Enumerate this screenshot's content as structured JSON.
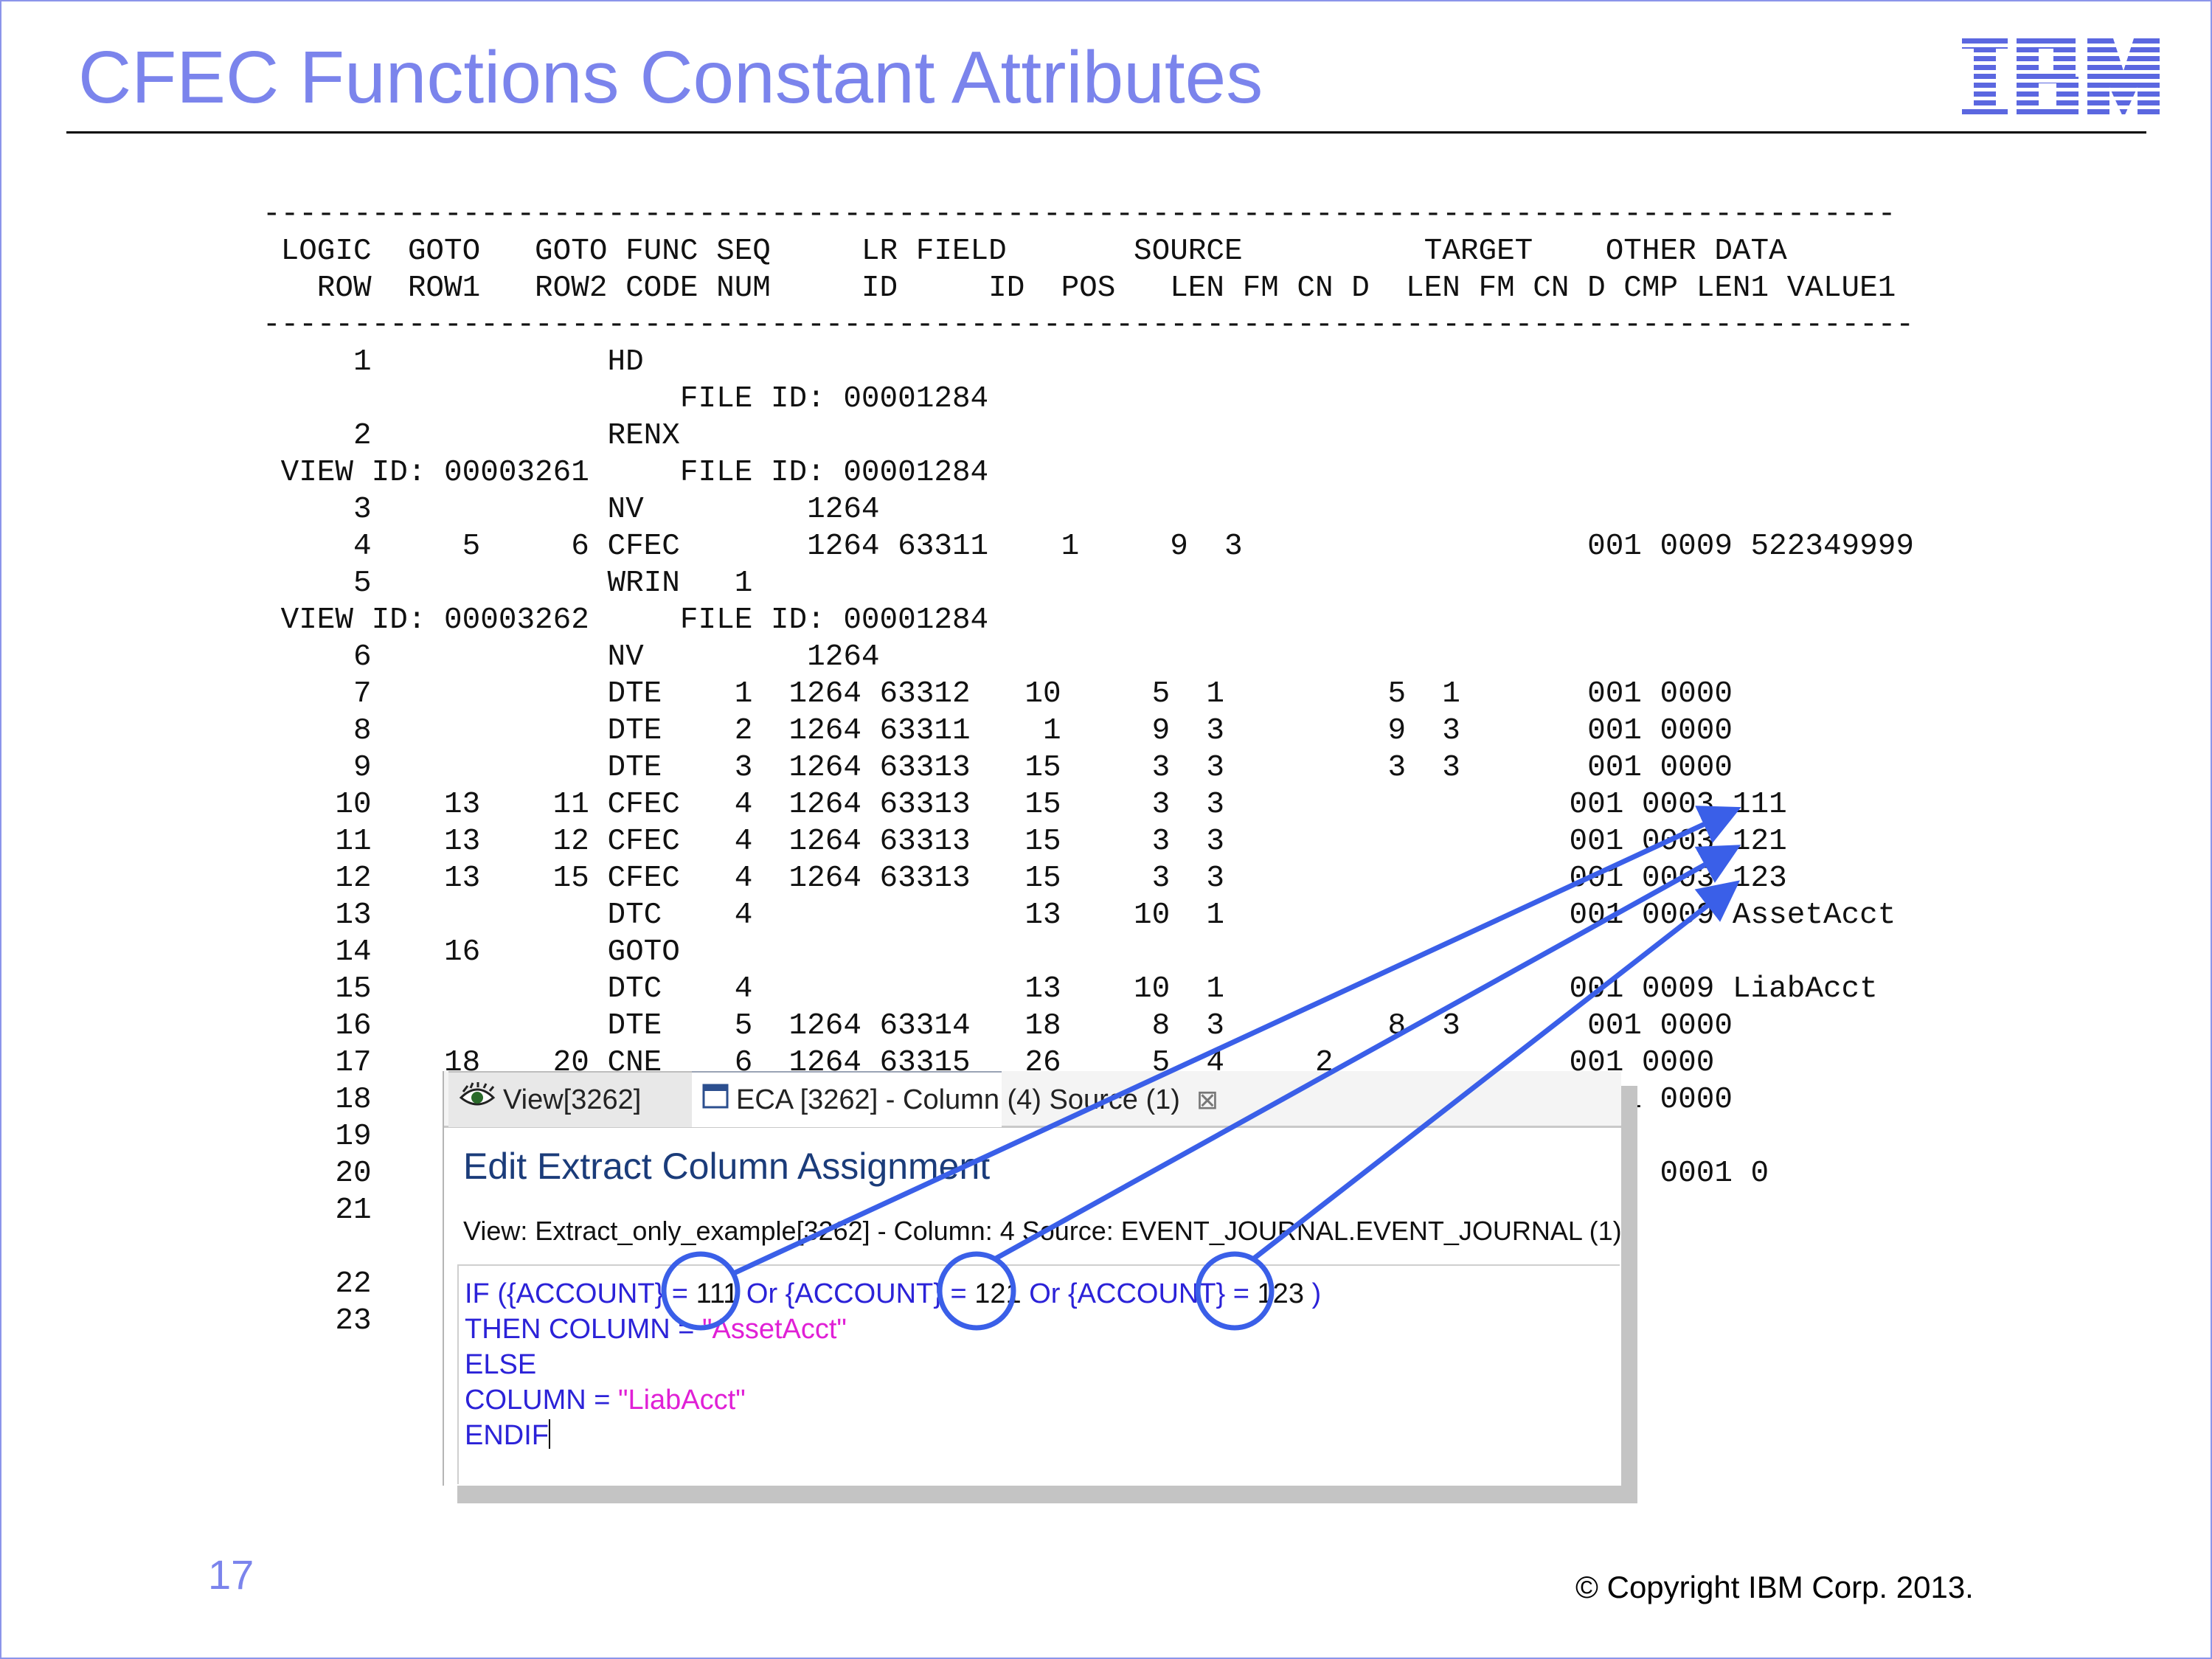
{
  "slide": {
    "title": "CFEC Functions Constant Attributes",
    "page_number": "17",
    "copyright": "© Copyright IBM Corp. 2013.",
    "logo": "IBM",
    "colors": {
      "title": "#7b84ec",
      "annotation": "#3a5fe8"
    }
  },
  "listing": {
    "lines": [
      "------------------------------------------------------------------------------------------",
      " LOGIC  GOTO   GOTO FUNC SEQ     LR FIELD       SOURCE          TARGET    OTHER DATA",
      "   ROW  ROW1   ROW2 CODE NUM     ID     ID  POS   LEN FM CN D  LEN FM CN D CMP LEN1 VALUE1",
      "-------------------------------------------------------------------------------------------",
      "     1             HD",
      "                       FILE ID: 00001284",
      "     2             RENX",
      " VIEW ID: 00003261     FILE ID: 00001284",
      "     3             NV         1264",
      "     4     5     6 CFEC       1264 63311    1     9  3                   001 0009 522349999",
      "     5             WRIN   1",
      " VIEW ID: 00003262     FILE ID: 00001284",
      "     6             NV         1264",
      "     7             DTE    1  1264 63312   10     5  1         5  1       001 0000",
      "     8             DTE    2  1264 63311    1     9  3         9  3       001 0000",
      "     9             DTE    3  1264 63313   15     3  3         3  3       001 0000",
      "    10    13    11 CFEC   4  1264 63313   15     3  3                   001 0003 111",
      "    11    13    12 CFEC   4  1264 63313   15     3  3                   001 0003 121",
      "    12    13    15 CFEC   4  1264 63313   15     3  3                   001 0003 123",
      "    13             DTC    4               13    10  1                   001 0009 AssetAcct",
      "    14    16       GOTO",
      "    15             DTC    4               13    10  1                   001 0009 LiabAcct",
      "    16             DTE    5  1264 63314   18     8  3         8  3       001 0000",
      "    17    18    20 CNE    6  1264 63315   26     5  4     2             001 0000",
      "    18                                                                   001 0000",
      "    19",
      "    20                                                                       0001 0",
      "    21",
      "",
      "    22",
      "    23"
    ]
  },
  "dialog": {
    "tabs": [
      {
        "label": "View[3262]",
        "icon": "eye-icon",
        "active": false
      },
      {
        "label": "ECA [3262] - Column (4) Source (1)",
        "icon": "window-icon",
        "active": true,
        "close": "⊠"
      }
    ],
    "heading": "Edit Extract Column Assignment",
    "subtitle": "View: Extract_only_example[3262] - Column: 4 Source: EVENT_JOURNAL.EVENT_JOURNAL (1)",
    "code": {
      "line1": {
        "kw1": "IF ({ACCOUNT} = ",
        "v1": "111",
        "kw2": " Or {ACCOUNT} = ",
        "v2": "121",
        "kw3": " Or {ACCOUNT} = ",
        "v3": "123",
        "kw4": " )"
      },
      "line2": {
        "kw": "THEN COLUMN = ",
        "str": "\"AssetAcct\""
      },
      "line3": {
        "kw": "ELSE"
      },
      "line4": {
        "kw": "COLUMN = ",
        "str": "\"LiabAcct\""
      },
      "line5": {
        "kw": "ENDIF"
      }
    }
  }
}
